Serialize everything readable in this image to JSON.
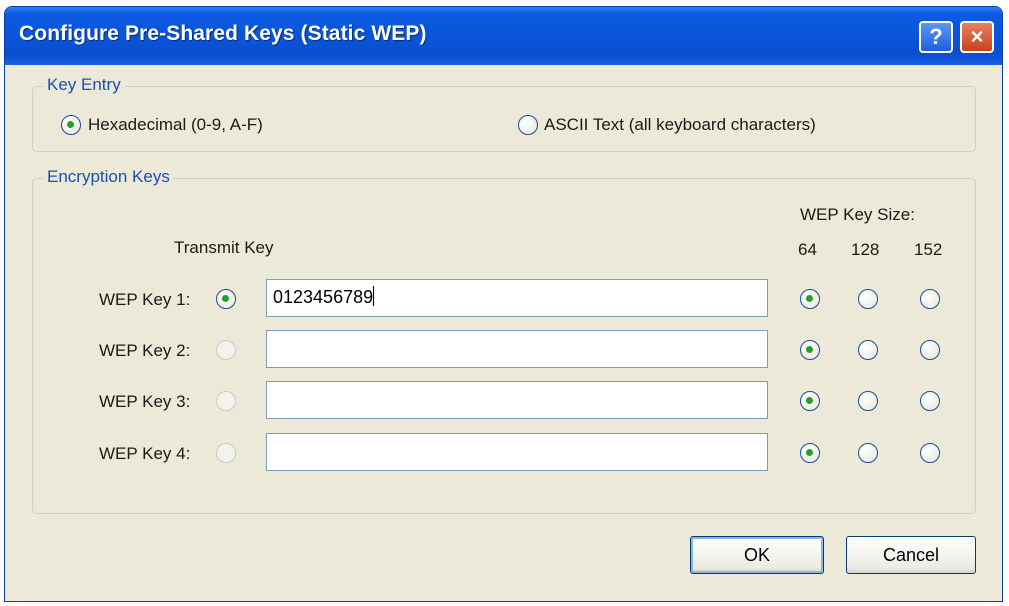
{
  "window": {
    "title": "Configure Pre-Shared Keys (Static WEP)",
    "help_label": "?",
    "close_label": "×"
  },
  "key_entry": {
    "group_label": "Key Entry",
    "options": [
      {
        "label": "Hexadecimal (0-9, A-F)",
        "checked": true
      },
      {
        "label": "ASCII Text (all keyboard characters)",
        "checked": false
      }
    ]
  },
  "encryption_keys": {
    "group_label": "Encryption Keys",
    "transmit_header": "Transmit Key",
    "size_header": "WEP Key Size:",
    "size_options": [
      "64",
      "128",
      "152"
    ],
    "keys": [
      {
        "label": "WEP Key 1:",
        "value": "0123456789",
        "transmit": true,
        "size": "64"
      },
      {
        "label": "WEP Key 2:",
        "value": "",
        "transmit": false,
        "size": "64"
      },
      {
        "label": "WEP Key 3:",
        "value": "",
        "transmit": false,
        "size": "64"
      },
      {
        "label": "WEP Key 4:",
        "value": "",
        "transmit": false,
        "size": "64"
      }
    ]
  },
  "buttons": {
    "ok": "OK",
    "cancel": "Cancel"
  },
  "colors": {
    "title_bar": "#0a55da",
    "dialog_bg": "#ece9d8",
    "group_label": "#1c4fb0",
    "radio_dot": "#27a027"
  }
}
